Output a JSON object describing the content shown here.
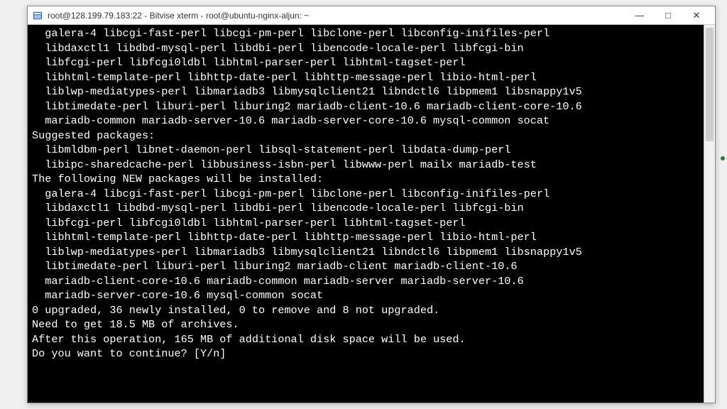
{
  "window": {
    "title": "root@128.199.79.183:22 - Bitvise xterm - root@ubuntu-nginx-aljun: ~"
  },
  "winbuttons": {
    "minimize": "—",
    "maximize": "□",
    "close": "✕"
  },
  "terminal": {
    "lines": [
      {
        "indent": true,
        "text": "galera-4 libcgi-fast-perl libcgi-pm-perl libclone-perl libconfig-inifiles-perl"
      },
      {
        "indent": true,
        "text": "libdaxctl1 libdbd-mysql-perl libdbi-perl libencode-locale-perl libfcgi-bin"
      },
      {
        "indent": true,
        "text": "libfcgi-perl libfcgi0ldbl libhtml-parser-perl libhtml-tagset-perl"
      },
      {
        "indent": true,
        "text": "libhtml-template-perl libhttp-date-perl libhttp-message-perl libio-html-perl"
      },
      {
        "indent": true,
        "text": "liblwp-mediatypes-perl libmariadb3 libmysqlclient21 libndctl6 libpmem1 libsnappy1v5"
      },
      {
        "indent": true,
        "text": "libtimedate-perl liburi-perl liburing2 mariadb-client-10.6 mariadb-client-core-10.6"
      },
      {
        "indent": true,
        "text": "mariadb-common mariadb-server-10.6 mariadb-server-core-10.6 mysql-common socat"
      },
      {
        "indent": false,
        "text": "Suggested packages:"
      },
      {
        "indent": true,
        "text": "libmldbm-perl libnet-daemon-perl libsql-statement-perl libdata-dump-perl"
      },
      {
        "indent": true,
        "text": "libipc-sharedcache-perl libbusiness-isbn-perl libwww-perl mailx mariadb-test"
      },
      {
        "indent": false,
        "text": "The following NEW packages will be installed:"
      },
      {
        "indent": true,
        "text": "galera-4 libcgi-fast-perl libcgi-pm-perl libclone-perl libconfig-inifiles-perl"
      },
      {
        "indent": true,
        "text": "libdaxctl1 libdbd-mysql-perl libdbi-perl libencode-locale-perl libfcgi-bin"
      },
      {
        "indent": true,
        "text": "libfcgi-perl libfcgi0ldbl libhtml-parser-perl libhtml-tagset-perl"
      },
      {
        "indent": true,
        "text": "libhtml-template-perl libhttp-date-perl libhttp-message-perl libio-html-perl"
      },
      {
        "indent": true,
        "text": "liblwp-mediatypes-perl libmariadb3 libmysqlclient21 libndctl6 libpmem1 libsnappy1v5"
      },
      {
        "indent": true,
        "text": "libtimedate-perl liburi-perl liburing2 mariadb-client mariadb-client-10.6"
      },
      {
        "indent": true,
        "text": "mariadb-client-core-10.6 mariadb-common mariadb-server mariadb-server-10.6"
      },
      {
        "indent": true,
        "text": "mariadb-server-core-10.6 mysql-common socat"
      },
      {
        "indent": false,
        "text": "0 upgraded, 36 newly installed, 0 to remove and 8 not upgraded."
      },
      {
        "indent": false,
        "text": "Need to get 18.5 MB of archives."
      },
      {
        "indent": false,
        "text": "After this operation, 165 MB of additional disk space will be used."
      },
      {
        "indent": false,
        "text": "Do you want to continue? [Y/n] "
      }
    ]
  }
}
